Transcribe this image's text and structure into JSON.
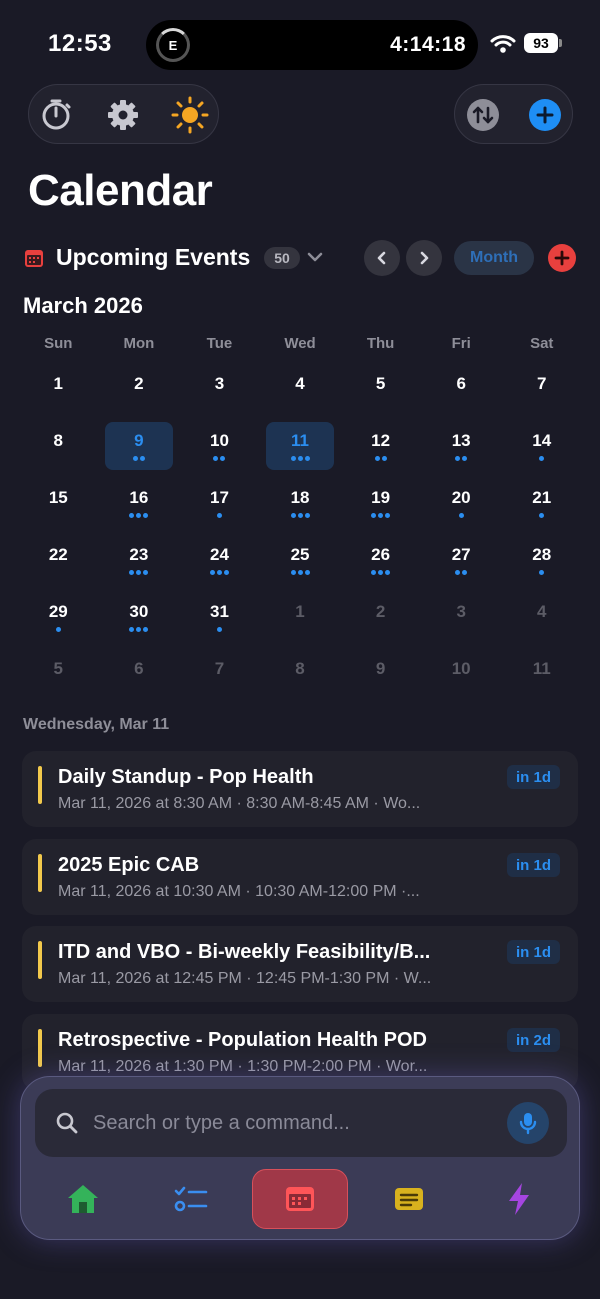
{
  "status": {
    "time": "12:53",
    "island_letter": "E",
    "timer": "4:14:18",
    "battery": "93"
  },
  "colors": {
    "accent": "#2b8ef0",
    "event_bar": "#f2c94c",
    "danger": "#e8403e",
    "background": "#1a1a26"
  },
  "toolbar": {
    "left_icons": [
      "timer-icon",
      "gear-icon",
      "sun-icon"
    ],
    "right_icons": [
      "sort-icon",
      "plus-icon"
    ]
  },
  "page_title": "Calendar",
  "upcoming": {
    "label": "Upcoming Events",
    "count": "50",
    "view_mode": "Month"
  },
  "calendar": {
    "month_label": "March 2026",
    "weekdays": [
      "Sun",
      "Mon",
      "Tue",
      "Wed",
      "Thu",
      "Fri",
      "Sat"
    ],
    "weeks": [
      [
        {
          "d": "1",
          "dots": 0
        },
        {
          "d": "2",
          "dots": 0
        },
        {
          "d": "3",
          "dots": 0
        },
        {
          "d": "4",
          "dots": 0
        },
        {
          "d": "5",
          "dots": 0
        },
        {
          "d": "6",
          "dots": 0
        },
        {
          "d": "7",
          "dots": 0
        }
      ],
      [
        {
          "d": "8",
          "dots": 0
        },
        {
          "d": "9",
          "dots": 2,
          "sel": true
        },
        {
          "d": "10",
          "dots": 2
        },
        {
          "d": "11",
          "dots": 3,
          "sel": true
        },
        {
          "d": "12",
          "dots": 2
        },
        {
          "d": "13",
          "dots": 2
        },
        {
          "d": "14",
          "dots": 1
        }
      ],
      [
        {
          "d": "15",
          "dots": 0
        },
        {
          "d": "16",
          "dots": 3
        },
        {
          "d": "17",
          "dots": 1
        },
        {
          "d": "18",
          "dots": 3
        },
        {
          "d": "19",
          "dots": 3
        },
        {
          "d": "20",
          "dots": 1
        },
        {
          "d": "21",
          "dots": 1
        }
      ],
      [
        {
          "d": "22",
          "dots": 0
        },
        {
          "d": "23",
          "dots": 3
        },
        {
          "d": "24",
          "dots": 3
        },
        {
          "d": "25",
          "dots": 3
        },
        {
          "d": "26",
          "dots": 3
        },
        {
          "d": "27",
          "dots": 2
        },
        {
          "d": "28",
          "dots": 1
        }
      ],
      [
        {
          "d": "29",
          "dots": 1
        },
        {
          "d": "30",
          "dots": 3
        },
        {
          "d": "31",
          "dots": 1
        },
        {
          "d": "1",
          "dots": 0,
          "muted": true
        },
        {
          "d": "2",
          "dots": 0,
          "muted": true
        },
        {
          "d": "3",
          "dots": 0,
          "muted": true
        },
        {
          "d": "4",
          "dots": 0,
          "muted": true
        }
      ],
      [
        {
          "d": "5",
          "dots": 0,
          "muted": true
        },
        {
          "d": "6",
          "dots": 0,
          "muted": true
        },
        {
          "d": "7",
          "dots": 0,
          "muted": true
        },
        {
          "d": "8",
          "dots": 0,
          "muted": true
        },
        {
          "d": "9",
          "dots": 0,
          "muted": true
        },
        {
          "d": "10",
          "dots": 0,
          "muted": true
        },
        {
          "d": "11",
          "dots": 0,
          "muted": true
        }
      ]
    ]
  },
  "events_heading": "Wednesday, Mar 11",
  "events": [
    {
      "title": "Daily Standup - Pop Health",
      "subtitle": "Mar 11, 2026 at 8:30 AM · 8:30 AM-8:45 AM · Wo...",
      "badge": "in 1d"
    },
    {
      "title": "2025 Epic CAB",
      "subtitle": "Mar 11, 2026 at 10:30 AM · 10:30 AM-12:00 PM ·...",
      "badge": "in 1d"
    },
    {
      "title": "ITD and VBO - Bi-weekly Feasibility/B...",
      "subtitle": "Mar 11, 2026 at 12:45 PM · 12:45 PM-1:30 PM · W...",
      "badge": "in 1d"
    },
    {
      "title": "Retrospective - Population Health POD",
      "subtitle": "Mar 11, 2026 at 1:30 PM · 1:30 PM-2:00 PM · Wor...",
      "badge": "in 2d"
    }
  ],
  "search": {
    "placeholder": "Search or type a command..."
  },
  "tabs": [
    {
      "icon": "home-icon",
      "active": false
    },
    {
      "icon": "checklist-icon",
      "active": false
    },
    {
      "icon": "calendar-icon",
      "active": true
    },
    {
      "icon": "notes-icon",
      "active": false
    },
    {
      "icon": "bolt-icon",
      "active": false
    }
  ]
}
